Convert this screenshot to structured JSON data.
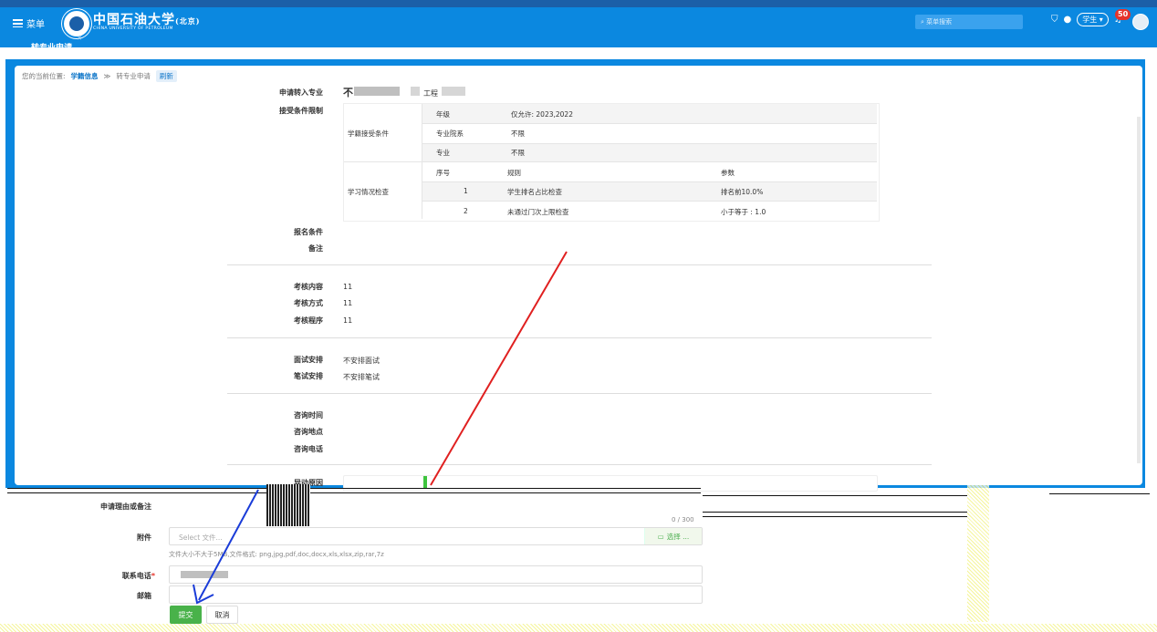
{
  "header": {
    "menu_label": "菜单",
    "school_name_cn": "中国石油大学",
    "school_name_suffix": "(北京)",
    "school_name_en": "CHINA UNIVERSITY OF PETROLEUM",
    "search_placeholder": "菜单搜索",
    "role_label": "学生",
    "notification_count": "50",
    "page_title": "转专业申请"
  },
  "breadcrumb": {
    "prefix": "您的当前位置:",
    "level1": "学籍信息",
    "separator": "≫",
    "level2": "转专业申请",
    "refresh": "刷新"
  },
  "form": {
    "apply_major_label": "申请转入专业",
    "apply_major_value_suffix": "工程",
    "accept_limit_label": "接受条件限制",
    "accept_conditions": {
      "group_label": "学籍接受条件",
      "rows": [
        {
          "key": "年级",
          "value": "仅允许: 2023,2022"
        },
        {
          "key": "专业院系",
          "value": "不限"
        },
        {
          "key": "专业",
          "value": "不限"
        }
      ]
    },
    "study_check": {
      "group_label": "学习情况检查",
      "headers": [
        "序号",
        "规则",
        "参数"
      ],
      "rows": [
        {
          "no": "1",
          "rule": "学生排名占比检查",
          "param": "排名前10.0%"
        },
        {
          "no": "2",
          "rule": "未通过门次上限检查",
          "param": "小于等于 : 1.0"
        }
      ]
    },
    "signup_cond_label": "报名条件",
    "remark_label": "备注",
    "assess_content_label": "考核内容",
    "assess_content_value": "11",
    "assess_method_label": "考核方式",
    "assess_method_value": "11",
    "assess_procedure_label": "考核程序",
    "assess_procedure_value": "11",
    "interview_label": "面试安排",
    "interview_value": "不安排面试",
    "written_label": "笔试安排",
    "written_value": "不安排笔试",
    "consult_time_label": "咨询时间",
    "consult_place_label": "咨询地点",
    "consult_phone_label": "咨询电话",
    "overlap_label": "异动原因",
    "reason_label": "申请理由或备注",
    "char_count": "0 / 300",
    "attachment_label": "附件",
    "attachment_placeholder": "Select 文件...",
    "choose_label": "选择 ...",
    "attachment_hint": "文件大小不大于5MB,文件格式: png,jpg,pdf,doc,docx,xls,xlsx,zip,rar,7z",
    "phone_label": "联系电话",
    "email_label": "邮箱",
    "submit_label": "提交",
    "cancel_label": "取消"
  },
  "colors": {
    "brand": "#0b88e0",
    "submit": "#49b24a",
    "badge": "#e5332a"
  },
  "icons": [
    "menu-icon",
    "university-logo",
    "search-icon",
    "shirt-icon",
    "help-icon",
    "bell-icon",
    "avatar",
    "folder-icon"
  ]
}
